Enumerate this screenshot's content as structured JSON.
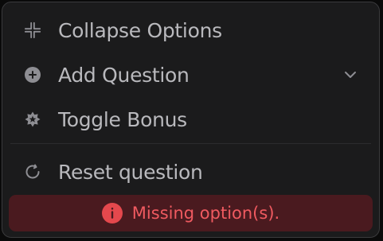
{
  "menu": {
    "items": [
      {
        "label": "Collapse Options",
        "icon": "collapse-icon"
      },
      {
        "label": "Add Question",
        "icon": "plus-circle-icon"
      },
      {
        "label": "Toggle Bonus",
        "icon": "star-badge-icon"
      },
      {
        "label": "Reset question",
        "icon": "reset-icon"
      }
    ]
  },
  "error": {
    "message": "Missing option(s).",
    "icon": "info-icon"
  },
  "colors": {
    "panel_bg": "#1b1b1c",
    "text": "#b9b9bd",
    "icon": "#8e8e93",
    "error_bg": "#4a1a1f",
    "error_text": "#f05a60",
    "error_icon": "#e5484d"
  }
}
